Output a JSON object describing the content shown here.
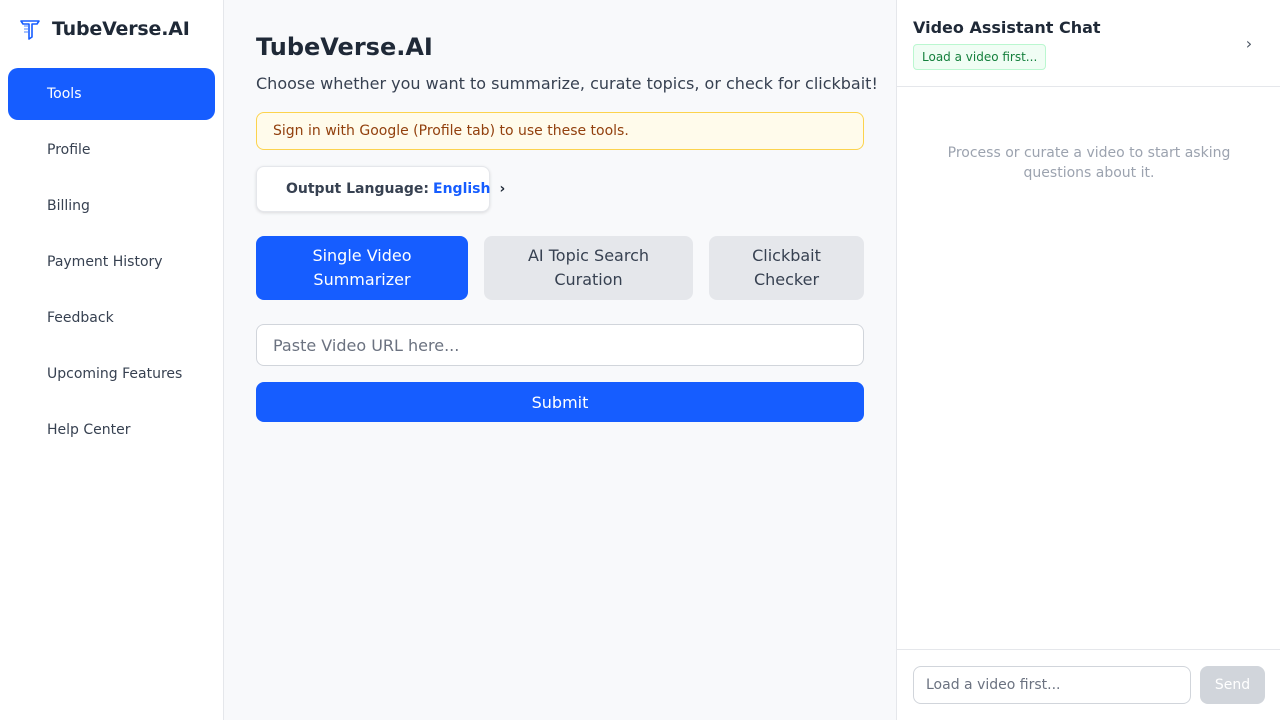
{
  "brand": {
    "name": "TubeVerse.AI",
    "logo_icon": "tubeverse-logo-icon",
    "accent": "#165dff"
  },
  "sidebar": {
    "items": [
      {
        "label": "Tools",
        "active": true
      },
      {
        "label": "Profile",
        "active": false
      },
      {
        "label": "Billing",
        "active": false
      },
      {
        "label": "Payment History",
        "active": false
      },
      {
        "label": "Feedback",
        "active": false
      },
      {
        "label": "Upcoming Features",
        "active": false
      },
      {
        "label": "Help Center",
        "active": false
      }
    ]
  },
  "main": {
    "title": "TubeVerse.AI",
    "subtitle": "Choose whether you want to summarize, curate topics, or check for clickbait!",
    "alert": "Sign in with Google (Profile tab) to use these tools.",
    "language": {
      "label": "Output Language:",
      "value": "English",
      "chevron": "›"
    },
    "modes": [
      {
        "line1": "Single Video",
        "line2": "Summarizer",
        "active": true
      },
      {
        "line1": "AI Topic Search",
        "line2": "Curation",
        "active": false
      },
      {
        "line1": "Clickbait",
        "line2": "Checker",
        "active": false
      }
    ],
    "url_placeholder": "Paste Video URL here...",
    "submit_label": "Submit"
  },
  "chat": {
    "title": "Video Assistant Chat",
    "badge": "Load a video first...",
    "collapse_glyph": "›",
    "empty_message": "Process or curate a video to start asking questions about it.",
    "input_placeholder": "Load a video first...",
    "send_label": "Send"
  }
}
